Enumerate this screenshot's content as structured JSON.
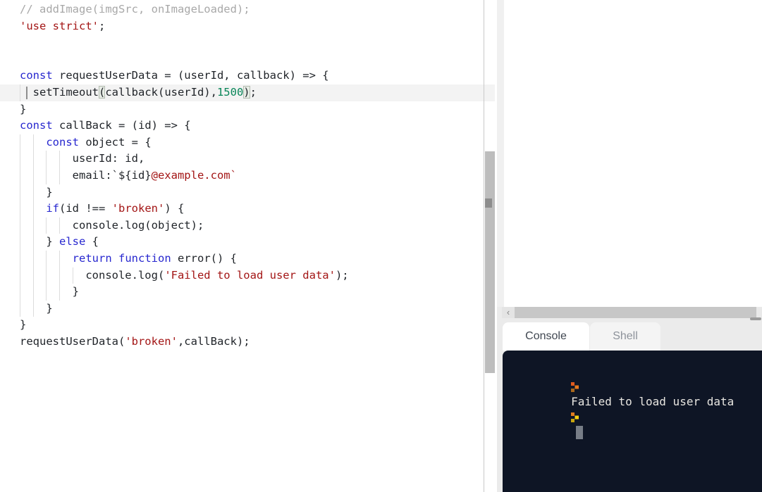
{
  "colors": {
    "keyword": "#2727cf",
    "string": "#a31515",
    "number": "#098658",
    "comment": "#a8a8a8",
    "plain": "#1f2328",
    "activeline": "#f3f3f3",
    "consolebg": "#0e1525",
    "consoletext": "#e8e6e1",
    "prompt1": [
      "#df5a1d",
      "#e87a1e",
      "#a8671c"
    ],
    "prompt2": [
      "#e07c1e",
      "#ffd012",
      "#c7a50e"
    ]
  },
  "editor": {
    "lines": [
      {
        "indent": 0,
        "active": false,
        "tokens": [
          [
            "c",
            "// addImage(imgSrc, onImageLoaded);"
          ]
        ]
      },
      {
        "indent": 0,
        "active": false,
        "tokens": [
          [
            "s",
            "'use strict'"
          ],
          [
            "p",
            ";"
          ]
        ]
      },
      {
        "indent": 0,
        "active": false,
        "tokens": []
      },
      {
        "indent": 0,
        "active": false,
        "tokens": []
      },
      {
        "indent": 0,
        "active": false,
        "tokens": [
          [
            "k",
            "const"
          ],
          [
            "p",
            " requestUserData = (userId, callback) => {"
          ]
        ]
      },
      {
        "indent": 2,
        "active": true,
        "tokens": [
          [
            "p",
            "  setTimeout"
          ],
          [
            "b",
            "("
          ],
          [
            "p",
            "callback(userId),"
          ],
          [
            "n",
            "1500"
          ],
          [
            "b",
            ")"
          ],
          [
            "p",
            ";"
          ]
        ]
      },
      {
        "indent": 0,
        "active": false,
        "tokens": [
          [
            "p",
            "}"
          ]
        ]
      },
      {
        "indent": 0,
        "active": false,
        "tokens": [
          [
            "k",
            "const"
          ],
          [
            "p",
            " callBack = (id) => {"
          ]
        ]
      },
      {
        "indent": 4,
        "active": false,
        "tokens": [
          [
            "p",
            "    "
          ],
          [
            "k",
            "const"
          ],
          [
            "p",
            " object = {"
          ]
        ]
      },
      {
        "indent": 8,
        "active": false,
        "tokens": [
          [
            "p",
            "        userId: id,"
          ]
        ]
      },
      {
        "indent": 8,
        "active": false,
        "tokens": [
          [
            "p",
            "        email:`${id}"
          ],
          [
            "s",
            "@example.com`"
          ]
        ]
      },
      {
        "indent": 4,
        "active": false,
        "tokens": [
          [
            "p",
            "    }"
          ]
        ]
      },
      {
        "indent": 4,
        "active": false,
        "tokens": [
          [
            "p",
            "    "
          ],
          [
            "k",
            "if"
          ],
          [
            "p",
            "(id !== "
          ],
          [
            "s",
            "'broken'"
          ],
          [
            "p",
            ") {"
          ]
        ]
      },
      {
        "indent": 8,
        "active": false,
        "tokens": [
          [
            "p",
            "        console.log(object);"
          ]
        ]
      },
      {
        "indent": 4,
        "active": false,
        "tokens": [
          [
            "p",
            "    } "
          ],
          [
            "k",
            "else"
          ],
          [
            "p",
            " {"
          ]
        ]
      },
      {
        "indent": 8,
        "active": false,
        "tokens": [
          [
            "p",
            "        "
          ],
          [
            "k",
            "return"
          ],
          [
            "p",
            " "
          ],
          [
            "k",
            "function"
          ],
          [
            "p",
            " error() {"
          ]
        ]
      },
      {
        "indent": 10,
        "active": false,
        "tokens": [
          [
            "p",
            "          console.log("
          ],
          [
            "s",
            "'Failed to load user data'"
          ],
          [
            "p",
            ");"
          ]
        ]
      },
      {
        "indent": 8,
        "active": false,
        "tokens": [
          [
            "p",
            "        }"
          ]
        ]
      },
      {
        "indent": 4,
        "active": false,
        "tokens": [
          [
            "p",
            "    }"
          ]
        ]
      },
      {
        "indent": 0,
        "active": false,
        "tokens": [
          [
            "p",
            "}"
          ]
        ]
      },
      {
        "indent": 0,
        "active": false,
        "tokens": [
          [
            "p",
            "requestUserData("
          ],
          [
            "s",
            "'broken'"
          ],
          [
            "p",
            ",callBack);"
          ]
        ]
      }
    ]
  },
  "console": {
    "tabs": [
      {
        "label": "Console",
        "active": true
      },
      {
        "label": "Shell",
        "active": false
      }
    ],
    "output": "Failed to load user data"
  },
  "hscroll": {
    "left_arrow": "‹"
  }
}
